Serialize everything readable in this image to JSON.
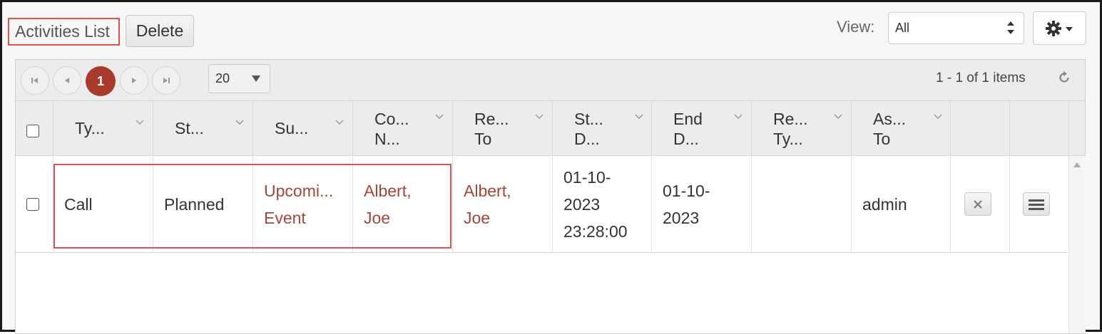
{
  "toolbar": {
    "title": "Activities List",
    "delete_label": "Delete",
    "view_label": "View:",
    "view_value": "All"
  },
  "pager": {
    "current_page": "1",
    "page_size": "20",
    "info": "1 - 1 of 1 items"
  },
  "columns": [
    {
      "l1": "Ty...",
      "l2": ""
    },
    {
      "l1": "St...",
      "l2": ""
    },
    {
      "l1": "Su...",
      "l2": ""
    },
    {
      "l1": "Co...",
      "l2": "N..."
    },
    {
      "l1": "Re...",
      "l2": "To"
    },
    {
      "l1": "St...",
      "l2": "D..."
    },
    {
      "l1": "End",
      "l2": "D..."
    },
    {
      "l1": "Re...",
      "l2": "Ty..."
    },
    {
      "l1": "As...",
      "l2": "To"
    }
  ],
  "rows": [
    {
      "type": "Call",
      "status": "Planned",
      "subject": [
        "Upcomi...",
        "Event"
      ],
      "contact": [
        "Albert,",
        "Joe"
      ],
      "regarding": [
        "Albert,",
        "Joe"
      ],
      "start": [
        "01-10-",
        "2023",
        "23:28:00"
      ],
      "end": [
        "01-10-",
        "2023"
      ],
      "regarding_type": "",
      "assigned": "admin"
    }
  ],
  "colors": {
    "link": "#a3463a",
    "accent": "#a83a2b",
    "highlight": "#d9534f"
  },
  "icons": {
    "settings": "gear-icon",
    "view_select": "up-down-arrows-icon",
    "refresh": "refresh-icon",
    "delete_row": "close-icon",
    "row_menu": "hamburger-menu-icon"
  }
}
